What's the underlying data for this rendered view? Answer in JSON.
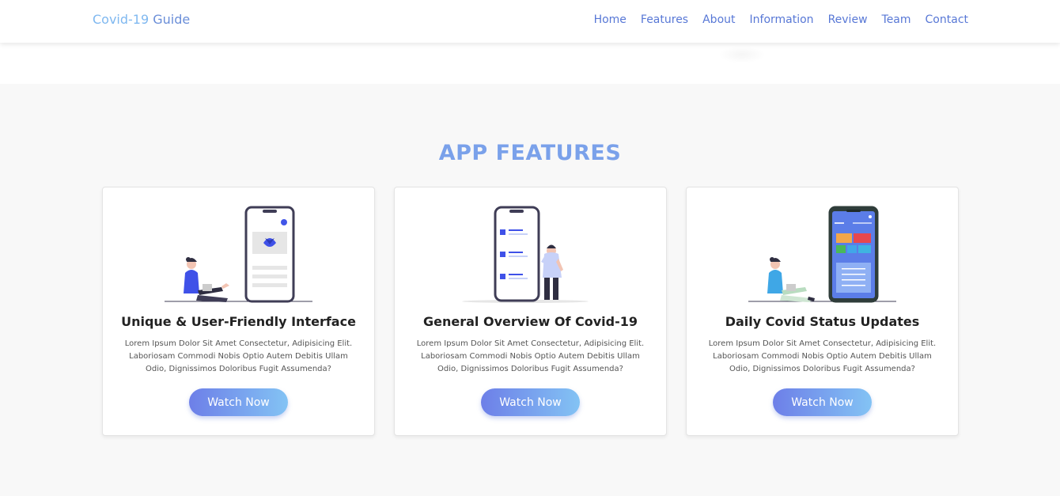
{
  "header": {
    "brand_part1": "Covid-19",
    "brand_part2": "Guide",
    "nav": [
      "Home",
      "Features",
      "About",
      "Information",
      "Review",
      "Team",
      "Contact"
    ]
  },
  "features": {
    "title": "APP FEATURES",
    "cards": [
      {
        "title": "Unique & User-Friendly Interface",
        "text": "Lorem Ipsum Dolor Sit Amet Consectetur, Adipisicing Elit. Laboriosam Commodi Nobis Optio Autem Debitis Ullam Odio, Dignissimos Doloribus Fugit Assumenda?",
        "button": "Watch Now"
      },
      {
        "title": "General Overview Of Covid-19",
        "text": "Lorem Ipsum Dolor Sit Amet Consectetur, Adipisicing Elit. Laboriosam Commodi Nobis Optio Autem Debitis Ullam Odio, Dignissimos Doloribus Fugit Assumenda?",
        "button": "Watch Now"
      },
      {
        "title": "Daily Covid Status Updates",
        "text": "Lorem Ipsum Dolor Sit Amet Consectetur, Adipisicing Elit. Laboriosam Commodi Nobis Optio Autem Debitis Ullam Odio, Dignissimos Doloribus Fugit Assumenda?",
        "button": "Watch Now"
      }
    ]
  },
  "colors": {
    "accent": "#7aa1ea",
    "button_start": "#6d7fe8",
    "button_end": "#83c3f4",
    "section_bg": "#f8f8f8"
  }
}
